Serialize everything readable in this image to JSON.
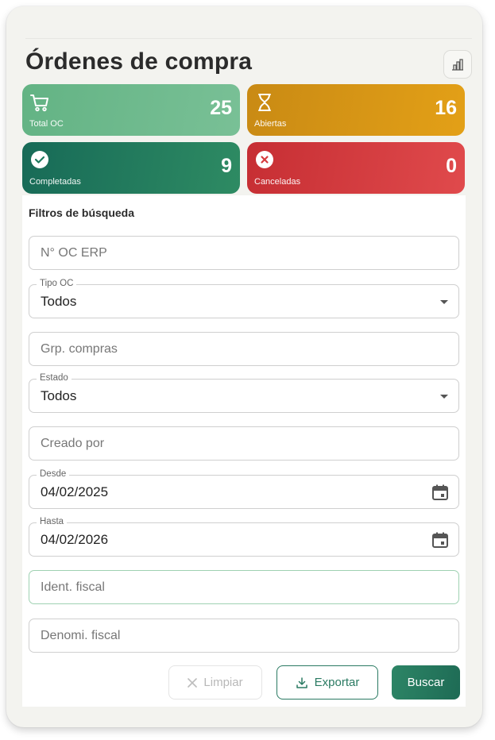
{
  "header": {
    "title": "Órdenes de compra",
    "chart_icon": "bar-chart-icon"
  },
  "stats": {
    "total": {
      "label": "Total OC",
      "value": "25",
      "icon": "cart-icon",
      "color": "#6dba8d"
    },
    "open": {
      "label": "Abiertas",
      "value": "16",
      "icon": "hourglass-icon",
      "color": "#d9961a"
    },
    "completed": {
      "label": "Completadas",
      "value": "9",
      "icon": "check-circle-icon",
      "color": "#1f7a5e"
    },
    "cancelled": {
      "label": "Canceladas",
      "value": "0",
      "icon": "x-circle-icon",
      "color": "#d63a3d"
    }
  },
  "filters": {
    "title": "Filtros de búsqueda",
    "oc_erp": {
      "placeholder": "N° OC ERP"
    },
    "tipo_oc": {
      "label": "Tipo OC",
      "value": "Todos"
    },
    "grp_compras": {
      "placeholder": "Grp. compras"
    },
    "estado": {
      "label": "Estado",
      "value": "Todos"
    },
    "creado_por": {
      "placeholder": "Creado por"
    },
    "desde": {
      "label": "Desde",
      "value": "04/02/2025"
    },
    "hasta": {
      "label": "Hasta",
      "value": "04/02/2026"
    },
    "ident_fiscal": {
      "placeholder": "Ident. fiscal"
    },
    "denomi_fiscal": {
      "placeholder": "Denomi. fiscal"
    }
  },
  "actions": {
    "clear": "Limpiar",
    "export": "Exportar",
    "search": "Buscar"
  },
  "colors": {
    "accent": "#2a7a62",
    "focus_border": "#9fd1b2"
  }
}
